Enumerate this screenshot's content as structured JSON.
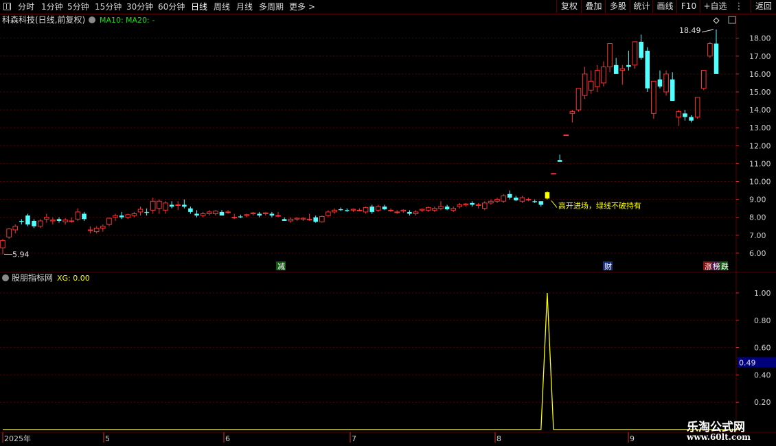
{
  "toolbar": {
    "left_icon": "grid-icon",
    "periods": [
      "分时",
      "1分钟",
      "5分钟",
      "15分钟",
      "30分钟",
      "60分钟",
      "日线",
      "周线",
      "月线",
      "多周期",
      "更多"
    ],
    "active_period": "日线",
    "more_arrow": ">",
    "right_buttons": [
      "复权",
      "叠加",
      "多股",
      "统计",
      "画线",
      "F10",
      "+自选",
      "返回"
    ]
  },
  "header": {
    "stock_name": "科森科技(日线,前复权)",
    "ma10_label": "MA10:",
    "ma20_label": "MA20: -",
    "ma_color": "#1fdc1f"
  },
  "indicator": {
    "name": "股朋指标网",
    "value_label": "XG: 0.00",
    "current_value_tag": "0.49"
  },
  "annotations": {
    "max_label": "18.49",
    "min_label": "5.94",
    "signal_text": "高开进场，绿线不破持有",
    "event_jian": "减",
    "event_cai": "财",
    "event_zhang": "涨",
    "event_bang": "榜",
    "event_die": "跌"
  },
  "colors": {
    "up": "#ff3232",
    "down": "#54ffff",
    "signal": "#ffff00",
    "grid": "#5a0000",
    "axis_text": "#d0d0d0"
  },
  "watermark": {
    "name": "乐淘公式网",
    "url": "www.60lt.com"
  },
  "chart_data": [
    {
      "type": "candlestick",
      "title": "科森科技(日线,前复权)",
      "y_axis_ticks": [
        "6.00",
        "7.00",
        "8.00",
        "9.00",
        "10.00",
        "11.00",
        "12.00",
        "13.00",
        "14.00",
        "15.00",
        "16.00",
        "17.00",
        "18.00"
      ],
      "x_axis_ticks": [
        "2025年",
        "5",
        "6",
        "7",
        "8",
        "9"
      ],
      "ylim": [
        5.5,
        18.6
      ],
      "candles": [
        {
          "o": 6.3,
          "h": 6.8,
          "l": 5.94,
          "c": 6.7
        },
        {
          "o": 6.9,
          "h": 7.4,
          "l": 6.8,
          "c": 7.35
        },
        {
          "o": 7.3,
          "h": 7.6,
          "l": 7.1,
          "c": 7.5
        },
        {
          "o": 7.8,
          "h": 7.9,
          "l": 7.6,
          "c": 7.75
        },
        {
          "o": 8.1,
          "h": 8.2,
          "l": 7.5,
          "c": 7.6
        },
        {
          "o": 7.8,
          "h": 7.9,
          "l": 7.4,
          "c": 7.5
        },
        {
          "o": 7.5,
          "h": 7.9,
          "l": 7.4,
          "c": 7.8
        },
        {
          "o": 7.9,
          "h": 8.2,
          "l": 7.7,
          "c": 8.0
        },
        {
          "o": 7.8,
          "h": 8.0,
          "l": 7.6,
          "c": 7.85
        },
        {
          "o": 7.9,
          "h": 8.0,
          "l": 7.7,
          "c": 7.8
        },
        {
          "o": 7.75,
          "h": 7.95,
          "l": 7.6,
          "c": 7.85
        },
        {
          "o": 7.8,
          "h": 8.0,
          "l": 7.7,
          "c": 7.8
        },
        {
          "o": 7.9,
          "h": 8.5,
          "l": 7.8,
          "c": 8.3
        },
        {
          "o": 8.2,
          "h": 8.3,
          "l": 7.8,
          "c": 7.9
        },
        {
          "o": 7.3,
          "h": 7.5,
          "l": 7.1,
          "c": 7.3
        },
        {
          "o": 7.2,
          "h": 7.5,
          "l": 7.1,
          "c": 7.4
        },
        {
          "o": 7.4,
          "h": 7.6,
          "l": 7.2,
          "c": 7.5
        },
        {
          "o": 7.6,
          "h": 8.0,
          "l": 7.5,
          "c": 7.95
        },
        {
          "o": 8.0,
          "h": 8.2,
          "l": 7.8,
          "c": 8.1
        },
        {
          "o": 8.1,
          "h": 8.3,
          "l": 7.9,
          "c": 8.0
        },
        {
          "o": 8.0,
          "h": 8.2,
          "l": 7.9,
          "c": 8.15
        },
        {
          "o": 8.1,
          "h": 8.3,
          "l": 8.0,
          "c": 8.2
        },
        {
          "o": 8.3,
          "h": 8.6,
          "l": 8.1,
          "c": 8.45
        },
        {
          "o": 8.3,
          "h": 8.5,
          "l": 8.1,
          "c": 8.25
        },
        {
          "o": 8.4,
          "h": 9.1,
          "l": 8.2,
          "c": 8.9
        },
        {
          "o": 8.5,
          "h": 9.0,
          "l": 8.2,
          "c": 8.9
        },
        {
          "o": 8.4,
          "h": 8.9,
          "l": 8.2,
          "c": 8.8
        },
        {
          "o": 8.7,
          "h": 8.9,
          "l": 8.5,
          "c": 8.6
        },
        {
          "o": 8.7,
          "h": 8.9,
          "l": 8.4,
          "c": 8.7
        },
        {
          "o": 8.7,
          "h": 9.0,
          "l": 8.5,
          "c": 8.6
        },
        {
          "o": 8.5,
          "h": 8.6,
          "l": 8.2,
          "c": 8.3
        },
        {
          "o": 8.2,
          "h": 8.4,
          "l": 8.0,
          "c": 8.1
        },
        {
          "o": 8.1,
          "h": 8.3,
          "l": 8.0,
          "c": 8.2
        },
        {
          "o": 8.2,
          "h": 8.4,
          "l": 8.1,
          "c": 8.3
        },
        {
          "o": 8.2,
          "h": 8.4,
          "l": 8.1,
          "c": 8.35
        },
        {
          "o": 8.3,
          "h": 8.4,
          "l": 8.1,
          "c": 8.1
        },
        {
          "o": 8.3,
          "h": 8.4,
          "l": 8.2,
          "c": 8.3
        },
        {
          "o": 8.0,
          "h": 8.2,
          "l": 7.9,
          "c": 8.0
        },
        {
          "o": 8.05,
          "h": 8.15,
          "l": 7.95,
          "c": 8.0
        },
        {
          "o": 8.1,
          "h": 8.2,
          "l": 8.0,
          "c": 8.15
        },
        {
          "o": 8.2,
          "h": 8.3,
          "l": 8.1,
          "c": 8.25
        },
        {
          "o": 8.2,
          "h": 8.3,
          "l": 8.0,
          "c": 8.1
        },
        {
          "o": 8.2,
          "h": 8.3,
          "l": 8.1,
          "c": 8.25
        },
        {
          "o": 8.2,
          "h": 8.3,
          "l": 8.0,
          "c": 8.1
        },
        {
          "o": 8.1,
          "h": 8.3,
          "l": 8.0,
          "c": 8.1
        },
        {
          "o": 7.9,
          "h": 8.0,
          "l": 7.8,
          "c": 7.8
        },
        {
          "o": 7.8,
          "h": 8.0,
          "l": 7.7,
          "c": 7.9
        },
        {
          "o": 7.9,
          "h": 8.0,
          "l": 7.8,
          "c": 7.95
        },
        {
          "o": 7.9,
          "h": 8.0,
          "l": 7.8,
          "c": 7.95
        },
        {
          "o": 7.9,
          "h": 8.2,
          "l": 7.8,
          "c": 7.9
        },
        {
          "o": 8.0,
          "h": 8.1,
          "l": 7.7,
          "c": 7.75
        },
        {
          "o": 7.75,
          "h": 8.1,
          "l": 7.7,
          "c": 8.05
        },
        {
          "o": 8.1,
          "h": 8.4,
          "l": 8.0,
          "c": 8.3
        },
        {
          "o": 8.3,
          "h": 8.5,
          "l": 8.2,
          "c": 8.4
        },
        {
          "o": 8.45,
          "h": 8.55,
          "l": 8.35,
          "c": 8.4
        },
        {
          "o": 8.4,
          "h": 8.5,
          "l": 8.3,
          "c": 8.35
        },
        {
          "o": 8.4,
          "h": 8.5,
          "l": 8.3,
          "c": 8.45
        },
        {
          "o": 8.4,
          "h": 8.5,
          "l": 8.35,
          "c": 8.4
        },
        {
          "o": 8.3,
          "h": 8.6,
          "l": 8.2,
          "c": 8.55
        },
        {
          "o": 8.6,
          "h": 8.7,
          "l": 8.2,
          "c": 8.3
        },
        {
          "o": 8.4,
          "h": 8.7,
          "l": 8.3,
          "c": 8.6
        },
        {
          "o": 8.6,
          "h": 8.7,
          "l": 8.4,
          "c": 8.45
        },
        {
          "o": 8.4,
          "h": 8.5,
          "l": 8.3,
          "c": 8.4
        },
        {
          "o": 8.3,
          "h": 8.4,
          "l": 8.2,
          "c": 8.3
        },
        {
          "o": 8.35,
          "h": 8.45,
          "l": 8.25,
          "c": 8.4
        },
        {
          "o": 8.3,
          "h": 8.4,
          "l": 8.1,
          "c": 8.2
        },
        {
          "o": 8.2,
          "h": 8.4,
          "l": 8.1,
          "c": 8.3
        },
        {
          "o": 8.4,
          "h": 8.5,
          "l": 8.3,
          "c": 8.45
        },
        {
          "o": 8.4,
          "h": 8.6,
          "l": 8.3,
          "c": 8.55
        },
        {
          "o": 8.4,
          "h": 8.6,
          "l": 8.3,
          "c": 8.5
        },
        {
          "o": 8.5,
          "h": 8.9,
          "l": 8.4,
          "c": 8.6
        },
        {
          "o": 8.6,
          "h": 8.7,
          "l": 8.4,
          "c": 8.45
        },
        {
          "o": 8.4,
          "h": 8.6,
          "l": 8.3,
          "c": 8.5
        },
        {
          "o": 8.6,
          "h": 8.8,
          "l": 8.5,
          "c": 8.7
        },
        {
          "o": 8.7,
          "h": 8.8,
          "l": 8.6,
          "c": 8.75
        },
        {
          "o": 8.8,
          "h": 8.9,
          "l": 8.6,
          "c": 8.7
        },
        {
          "o": 8.7,
          "h": 8.8,
          "l": 8.5,
          "c": 8.7
        },
        {
          "o": 8.5,
          "h": 8.9,
          "l": 8.4,
          "c": 8.8
        },
        {
          "o": 8.8,
          "h": 9.0,
          "l": 8.7,
          "c": 8.9
        },
        {
          "o": 8.9,
          "h": 9.1,
          "l": 8.8,
          "c": 9.0
        },
        {
          "o": 8.9,
          "h": 9.3,
          "l": 8.8,
          "c": 9.2
        },
        {
          "o": 9.3,
          "h": 9.5,
          "l": 9.0,
          "c": 9.1
        },
        {
          "o": 9.1,
          "h": 9.2,
          "l": 8.9,
          "c": 8.95
        },
        {
          "o": 8.9,
          "h": 9.2,
          "l": 8.8,
          "c": 9.1
        },
        {
          "o": 9.0,
          "h": 9.1,
          "l": 8.9,
          "c": 9.0
        },
        {
          "o": 8.9,
          "h": 9.0,
          "l": 8.8,
          "c": 8.85
        },
        {
          "o": 8.9,
          "h": 8.9,
          "l": 8.6,
          "c": 8.7
        },
        {
          "o": 9.4,
          "h": 9.45,
          "l": 9.0,
          "c": 9.05
        },
        {
          "o": 10.45,
          "h": 10.45,
          "l": 10.45,
          "c": 10.45
        },
        {
          "o": 11.2,
          "h": 11.5,
          "l": 11.1,
          "c": 11.1
        },
        {
          "o": 12.6,
          "h": 12.6,
          "l": 12.6,
          "c": 12.6
        },
        {
          "o": 13.8,
          "h": 14.0,
          "l": 13.3,
          "c": 13.9
        },
        {
          "o": 14.0,
          "h": 15.2,
          "l": 13.9,
          "c": 15.2
        },
        {
          "o": 14.8,
          "h": 16.4,
          "l": 14.6,
          "c": 16.0
        },
        {
          "o": 15.1,
          "h": 16.2,
          "l": 14.9,
          "c": 15.6
        },
        {
          "o": 15.3,
          "h": 16.5,
          "l": 15.0,
          "c": 16.2
        },
        {
          "o": 15.5,
          "h": 16.7,
          "l": 15.3,
          "c": 16.4
        },
        {
          "o": 16.4,
          "h": 17.7,
          "l": 16.1,
          "c": 17.7
        },
        {
          "o": 16.5,
          "h": 16.9,
          "l": 16.0,
          "c": 16.0
        },
        {
          "o": 16.2,
          "h": 16.5,
          "l": 15.4,
          "c": 16.3
        },
        {
          "o": 16.5,
          "h": 17.3,
          "l": 16.2,
          "c": 16.4
        },
        {
          "o": 16.5,
          "h": 17.8,
          "l": 16.3,
          "c": 17.8
        },
        {
          "o": 17.8,
          "h": 18.2,
          "l": 16.8,
          "c": 16.9
        },
        {
          "o": 17.3,
          "h": 17.5,
          "l": 15.0,
          "c": 15.2
        },
        {
          "o": 13.8,
          "h": 14.2,
          "l": 13.5,
          "c": 15.6
        },
        {
          "o": 15.7,
          "h": 16.2,
          "l": 15.2,
          "c": 15.3
        },
        {
          "o": 15.0,
          "h": 16.2,
          "l": 14.8,
          "c": 16.0
        },
        {
          "o": 15.7,
          "h": 16.1,
          "l": 14.6,
          "c": 14.5
        },
        {
          "o": 13.6,
          "h": 14.0,
          "l": 13.1,
          "c": 13.9
        },
        {
          "o": 13.8,
          "h": 14.0,
          "l": 13.4,
          "c": 13.6
        },
        {
          "o": 13.6,
          "h": 13.7,
          "l": 13.3,
          "c": 13.4
        },
        {
          "o": 13.6,
          "h": 14.7,
          "l": 13.5,
          "c": 14.7
        },
        {
          "o": 15.2,
          "h": 16.2,
          "l": 15.1,
          "c": 16.2
        },
        {
          "o": 17.0,
          "h": 17.8,
          "l": 16.9,
          "c": 17.7
        },
        {
          "o": 17.7,
          "h": 18.49,
          "l": 16.0,
          "c": 16.0
        }
      ],
      "signal_candle_index": 87
    },
    {
      "type": "line",
      "title": "股朋指标网",
      "series": [
        {
          "name": "XG",
          "values_sparse": {
            "87": 1.0
          }
        }
      ],
      "y_axis_ticks": [
        "0.20",
        "0.40",
        "0.60",
        "0.80",
        "1.00"
      ],
      "ylim": [
        0.0,
        1.05
      ]
    }
  ]
}
